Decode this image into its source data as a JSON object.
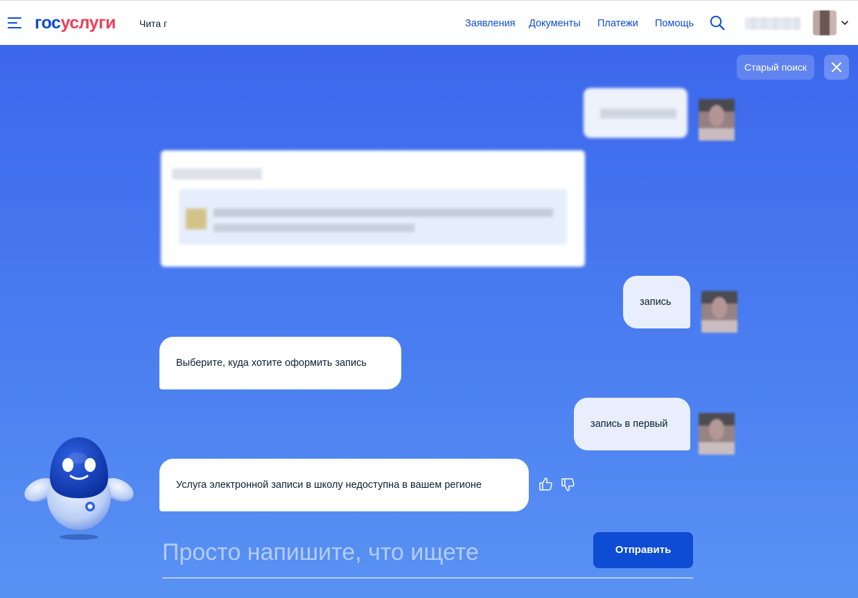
{
  "header": {
    "logo_part1": "гос",
    "logo_part2": "услуги",
    "city": "Чита г",
    "nav": [
      "Заявления",
      "Документы",
      "Платежи",
      "Помощь"
    ]
  },
  "chat": {
    "old_search_label": "Старый поиск",
    "messages": [
      {
        "from": "user",
        "text": "запись"
      },
      {
        "from": "bot",
        "text": "Выберите, куда хотите оформить запись"
      },
      {
        "from": "user",
        "text": "запись в первый"
      },
      {
        "from": "bot",
        "text": "Услуга электронной записи в школу недоступна в вашем регионе"
      }
    ],
    "input_placeholder": "Просто напишите, что ищете",
    "send_label": "Отправить"
  },
  "colors": {
    "brand_blue": "#0d4cd3",
    "brand_red": "#ee3f58",
    "chat_bg": "#4a7ef0"
  }
}
